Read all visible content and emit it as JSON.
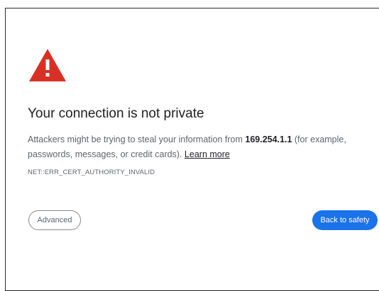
{
  "icons": {
    "warning": "warning-triangle-icon"
  },
  "colors": {
    "warning_red": "#d93025",
    "primary_blue": "#1a73e8",
    "title_text": "#202124",
    "body_text": "#5f6368"
  },
  "interstitial": {
    "title": "Your connection is not private",
    "desc_prefix": "Attackers might be trying to steal your information from ",
    "host": "169.254.1.1",
    "desc_suffix": " (for example, passwords, messages, or credit cards). ",
    "learn_more": "Learn more",
    "error_code": "NET::ERR_CERT_AUTHORITY_INVALID"
  },
  "buttons": {
    "advanced_label": "Advanced",
    "back_label": "Back to safety"
  }
}
